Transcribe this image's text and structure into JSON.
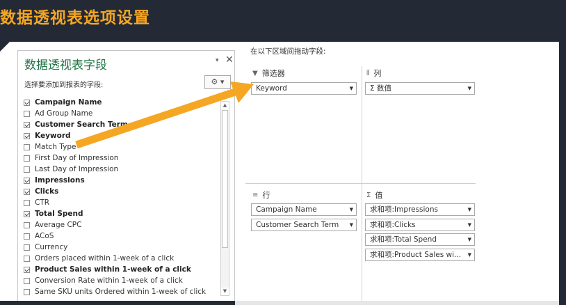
{
  "page_title": "数据透视表选项设置",
  "colors": {
    "title_accent": "#f5a623",
    "arrow": "#f5a623",
    "pane_title": "#217346",
    "dark_bg": "#232a35"
  },
  "field_pane": {
    "title": "数据透视表字段",
    "dropdown_glyph": "▾",
    "close_glyph": "✕",
    "subtitle": "选择要添加到报表的字段:",
    "gear_glyph": "⚙ ▾",
    "fields": [
      {
        "label": "Campaign Name",
        "checked": true
      },
      {
        "label": "Ad Group Name",
        "checked": false
      },
      {
        "label": "Customer Search Term",
        "checked": true
      },
      {
        "label": "Keyword",
        "checked": true
      },
      {
        "label": "Match Type",
        "checked": false
      },
      {
        "label": "First Day of Impression",
        "checked": false
      },
      {
        "label": "Last Day of Impression",
        "checked": false
      },
      {
        "label": "Impressions",
        "checked": true
      },
      {
        "label": "Clicks",
        "checked": true
      },
      {
        "label": "CTR",
        "checked": false
      },
      {
        "label": "Total Spend",
        "checked": true
      },
      {
        "label": "Average CPC",
        "checked": false
      },
      {
        "label": "ACoS",
        "checked": false
      },
      {
        "label": "Currency",
        "checked": false
      },
      {
        "label": "Orders placed within 1-week of a click",
        "checked": false
      },
      {
        "label": "Product Sales within 1-week of a click",
        "checked": true
      },
      {
        "label": "Conversion Rate within 1-week of a click",
        "checked": false
      },
      {
        "label": "Same SKU units Ordered within 1-week of click",
        "checked": false
      }
    ]
  },
  "areas": {
    "instruction": "在以下区域间拖动字段:",
    "filters": {
      "icon": "▼",
      "label": "筛选器",
      "items": [
        "Keyword"
      ]
    },
    "columns": {
      "icon": "⦀",
      "label": "列",
      "items": [
        "Σ  数值"
      ]
    },
    "rows": {
      "icon": "≡",
      "label": "行",
      "items": [
        "Campaign Name",
        "Customer Search Term"
      ]
    },
    "values": {
      "icon": "Σ",
      "label": "值",
      "items": [
        "求和项:Impressions",
        "求和项:Clicks",
        "求和项:Total Spend",
        "求和项:Product Sales wi..."
      ]
    }
  }
}
